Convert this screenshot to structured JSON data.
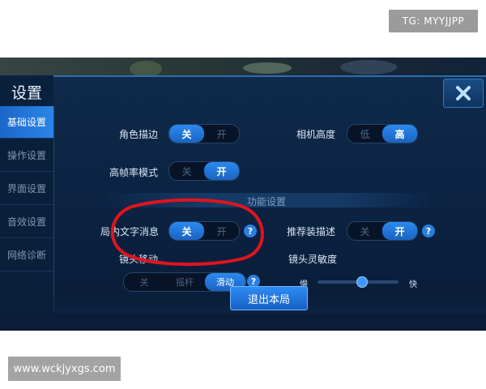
{
  "watermarks": {
    "top": "TG: MYYJJPP",
    "bottom": "www.wckjyxgs.com"
  },
  "settings": {
    "title": "设置",
    "close_icon": "close-x-icon",
    "sidebar": {
      "items": [
        {
          "label": "基础设置",
          "active": true
        },
        {
          "label": "操作设置",
          "active": false
        },
        {
          "label": "界面设置",
          "active": false
        },
        {
          "label": "音效设置",
          "active": false
        },
        {
          "label": "网络诊断",
          "active": false
        }
      ]
    },
    "options": {
      "role_outline": {
        "label": "角色描边",
        "off": "关",
        "on": "开",
        "selected": "关"
      },
      "camera_height": {
        "label": "相机高度",
        "low": "低",
        "high": "高",
        "selected": "高"
      },
      "high_fps": {
        "label": "高帧率模式",
        "off": "关",
        "on": "开",
        "selected": "开"
      },
      "section_title": "功能设置",
      "ingame_text": {
        "label": "局内文字消息",
        "off": "关",
        "on": "开",
        "selected": "关",
        "help": "?"
      },
      "recommend_desc": {
        "label": "推荐装描述",
        "off": "关",
        "on": "开",
        "selected": "开",
        "help": "?"
      },
      "camera_move": {
        "label": "镜头移动",
        "options": [
          "关",
          "摇杆",
          "滑动"
        ],
        "selected": "滑动",
        "help": "?"
      },
      "camera_sensitivity": {
        "label": "镜头灵敏度",
        "min_label": "慢",
        "max_label": "快",
        "value_fraction": 0.55
      }
    },
    "exit_button": "退出本局",
    "highlight_color": "#e0141e",
    "accent_color": "#2a86e8"
  }
}
